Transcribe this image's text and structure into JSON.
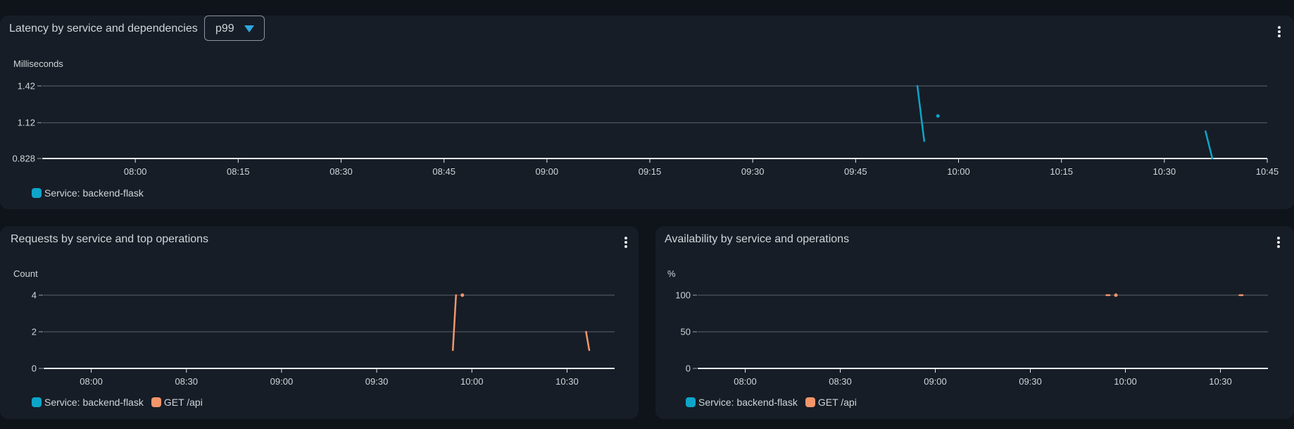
{
  "latency": {
    "title": "Latency by service and dependencies",
    "stat_select": "p99",
    "chart_data": {
      "type": "line",
      "ylabel": "Milliseconds",
      "ylim": [
        0.828,
        1.42
      ],
      "yticks": [
        "1.42",
        "1.12",
        "0.828"
      ],
      "ytick_values": [
        1.42,
        1.12,
        0.828
      ],
      "xlim": [
        "07:45",
        "10:45"
      ],
      "xticks": [
        "08:00",
        "08:15",
        "08:30",
        "08:45",
        "09:00",
        "09:15",
        "09:30",
        "09:45",
        "10:00",
        "10:15",
        "10:30",
        "10:45"
      ],
      "grid": true,
      "legend": "bottom-left",
      "series": [
        {
          "name": "Service: backend-flask",
          "color": "#0ea5c9",
          "segments": [
            [
              [
                "09:54",
                1.42
              ],
              [
                "09:55",
                0.97
              ]
            ],
            [
              [
                "09:57",
                1.175
              ]
            ],
            [
              [
                "10:36",
                1.05
              ],
              [
                "10:37",
                0.828
              ]
            ]
          ]
        }
      ]
    }
  },
  "requests": {
    "title": "Requests by service and top operations",
    "chart_data": {
      "type": "line",
      "ylabel": "Count",
      "ylim": [
        0,
        4
      ],
      "yticks": [
        "4",
        "2",
        "0"
      ],
      "ytick_values": [
        4,
        2,
        0
      ],
      "xlim": [
        "07:45",
        "10:45"
      ],
      "xticks": [
        "08:00",
        "08:30",
        "09:00",
        "09:30",
        "10:00",
        "10:30"
      ],
      "grid": true,
      "legend": "bottom-left",
      "series": [
        {
          "name": "Service: backend-flask",
          "color": "#0ea5c9",
          "segments": []
        },
        {
          "name": "GET /api",
          "color": "#f4956a",
          "segments": [
            [
              [
                "09:54",
                1
              ],
              [
                "09:55",
                4
              ]
            ],
            [
              [
                "09:57",
                4
              ]
            ],
            [
              [
                "10:36",
                2
              ],
              [
                "10:37",
                1
              ]
            ]
          ]
        }
      ]
    }
  },
  "availability": {
    "title": "Availability by service and operations",
    "chart_data": {
      "type": "line",
      "ylabel": "%",
      "ylim": [
        0,
        100
      ],
      "yticks": [
        "100",
        "50",
        "0"
      ],
      "ytick_values": [
        100,
        50,
        0
      ],
      "xlim": [
        "07:45",
        "10:45"
      ],
      "xticks": [
        "08:00",
        "08:30",
        "09:00",
        "09:30",
        "10:00",
        "10:30"
      ],
      "grid": true,
      "legend": "bottom-left",
      "series": [
        {
          "name": "Service: backend-flask",
          "color": "#0ea5c9",
          "segments": []
        },
        {
          "name": "GET /api",
          "color": "#f4956a",
          "segments": [
            [
              [
                "09:54",
                100
              ],
              [
                "09:55",
                100
              ]
            ],
            [
              [
                "09:57",
                100
              ]
            ],
            [
              [
                "10:36",
                100
              ],
              [
                "10:37",
                100
              ]
            ]
          ]
        }
      ]
    }
  }
}
